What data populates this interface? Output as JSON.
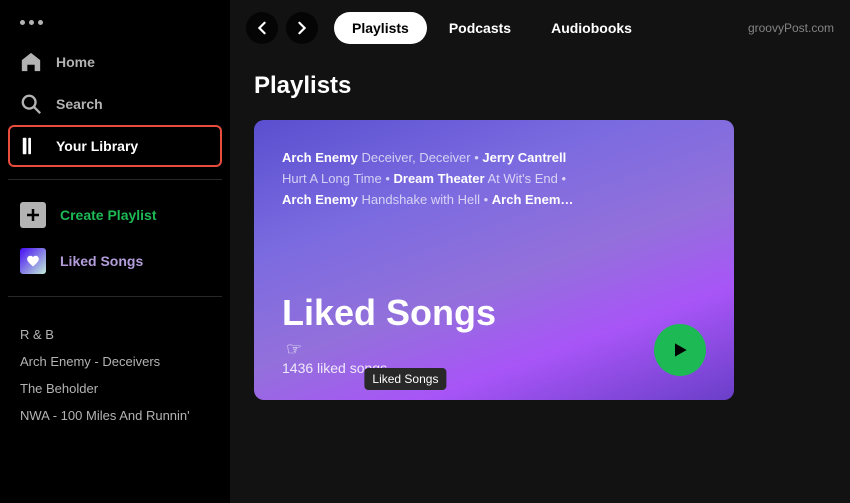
{
  "sidebar": {
    "dots_label": "···",
    "nav_items": [
      {
        "id": "home",
        "label": "Home",
        "active": false
      },
      {
        "id": "search",
        "label": "Search",
        "active": false
      },
      {
        "id": "your-library",
        "label": "Your Library",
        "active": true
      }
    ],
    "actions": [
      {
        "id": "create-playlist",
        "label": "Create Playlist"
      },
      {
        "id": "liked-songs",
        "label": "Liked Songs"
      }
    ],
    "playlists": [
      {
        "id": "rnb",
        "label": "R & B"
      },
      {
        "id": "arch-enemy",
        "label": "Arch Enemy - Deceivers"
      },
      {
        "id": "beholder",
        "label": "The Beholder"
      },
      {
        "id": "nwa",
        "label": "NWA - 100 Miles And Runnin'"
      }
    ]
  },
  "topbar": {
    "back_label": "‹",
    "forward_label": "›",
    "tabs": [
      {
        "id": "playlists",
        "label": "Playlists",
        "active": true
      },
      {
        "id": "podcasts",
        "label": "Podcasts",
        "active": false
      },
      {
        "id": "audiobooks",
        "label": "Audiobooks",
        "active": false
      }
    ],
    "watermark": "groovyPost.com"
  },
  "main": {
    "section_title": "Playlists",
    "card": {
      "track_line1_bold": "Arch Enemy",
      "track_line1_light1": " Deceiver, Deceiver • ",
      "track_line1_bold2": "Jerry Cantrell",
      "track_line2_light1": "Hurt A Long Time • ",
      "track_line2_bold": "Dream Theater",
      "track_line2_light2": " At Wit's End •",
      "track_line3_bold": "Arch Enemy",
      "track_line3_light": " Handshake with Hell • ",
      "track_line3_bold2": "Arch Enem…",
      "title": "Liked Songs",
      "count": "1436 liked songs",
      "tooltip": "Liked Songs"
    }
  }
}
